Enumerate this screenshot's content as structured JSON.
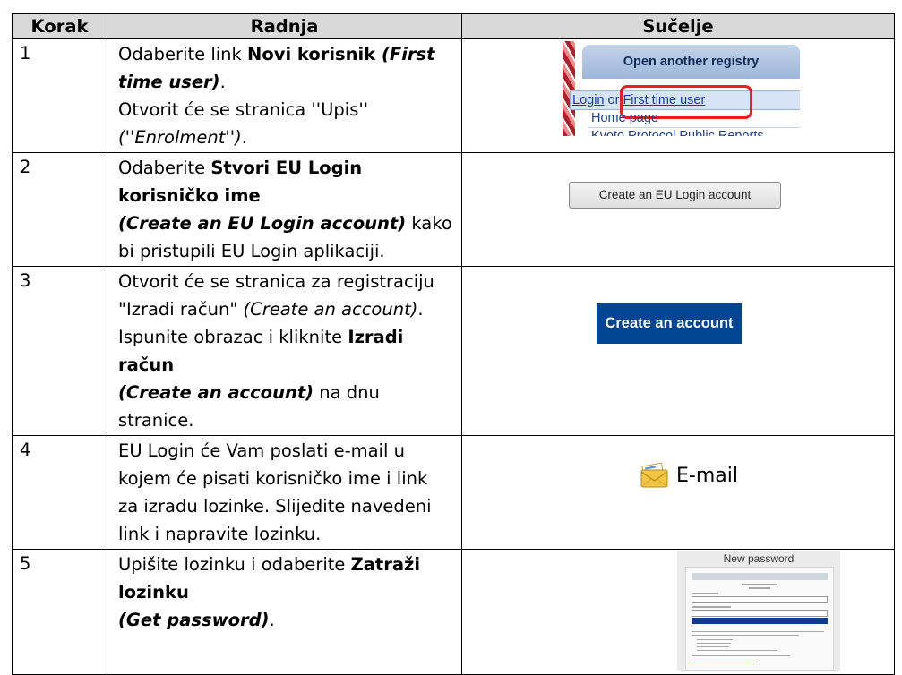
{
  "headers": {
    "step": "Korak",
    "action": "Radnja",
    "ui": "Sučelje"
  },
  "rows": [
    {
      "num": "1",
      "a1": "Odaberite link ",
      "a2": "Novi korisnik",
      "a3": " (First time user)",
      "a4": ".",
      "a5": "Otvorit će se stranica ''Upis'' ",
      "a6": "(''Enrolment'')",
      "a7": "."
    },
    {
      "num": "2",
      "a1": "Odaberite ",
      "a2": "Stvori EU Login korisničko ime",
      "a3": "(Create an EU Login account)",
      "a4": " kako bi pristupili EU Login aplikaciji."
    },
    {
      "num": "3",
      "a1": "Otvorit će se stranica za registraciju \"Izradi račun\" ",
      "a2": "(Create an account)",
      "a3": ".",
      "a4": "Ispunite obrazac i kliknite ",
      "a5": "Izradi račun",
      "a6": "(Create an account)",
      "a7": " na dnu stranice."
    },
    {
      "num": "4",
      "a1": "EU Login će Vam poslati e-mail u kojem će pisati korisničko ime i link za izradu lozinke. Slijedite navedeni link i napravite lozinku."
    },
    {
      "num": "5",
      "a1": "Upišite lozinku i odaberite ",
      "a2": "Zatraži lozinku",
      "a3": "(Get password)",
      "a4": "."
    }
  ],
  "ui": {
    "registry": {
      "header": "Open another registry",
      "login": "Login",
      "or": " or ",
      "first_time": "First time user",
      "home": "Home page",
      "kyoto": "Kyoto Protocol Public Reports"
    },
    "eu_login_button": "Create an EU Login account",
    "create_account_button": "Create an account",
    "email_label": "E-mail",
    "email_icon": "envelope-icon",
    "new_password_title": "New password"
  }
}
